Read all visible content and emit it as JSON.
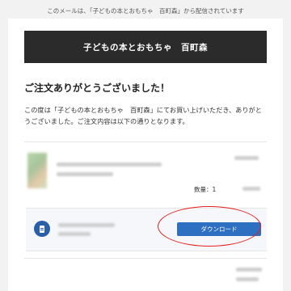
{
  "notice": "このメールは、「子どもの本とおもちゃ　百町森」から配信されています",
  "header": {
    "title": "子どもの本とおもちゃ　百町森"
  },
  "main": {
    "thanks": "ご注文ありがとうございました！",
    "message": "この度は「子どもの本とおもちゃ　百町森」にてお買い上げいただき、ありがとうございました。ご注文内容は以下の通りとなります。"
  },
  "order": {
    "quantity_label": "数量：1",
    "download_label": "ダウンロード"
  },
  "icons": {
    "file": "file-icon"
  },
  "colors": {
    "header_bg": "#2b2b2b",
    "button": "#2d6fc0",
    "annotation": "#e02020"
  }
}
